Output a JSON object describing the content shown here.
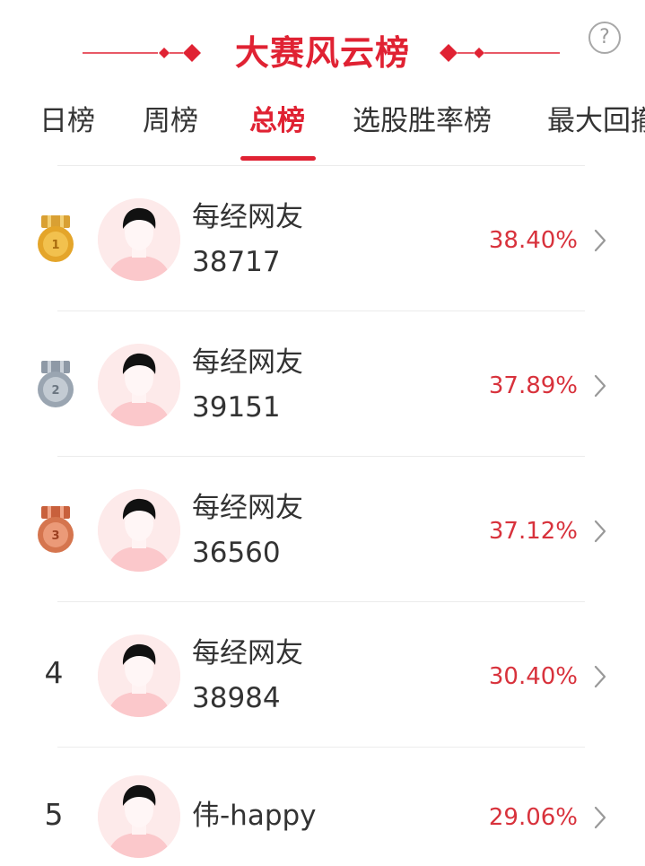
{
  "header": {
    "title": "大赛风云榜",
    "help_label": "?"
  },
  "tabs": [
    {
      "label": "日榜"
    },
    {
      "label": "周榜"
    },
    {
      "label": "总榜"
    },
    {
      "label": "选股胜率榜"
    },
    {
      "label": "最大回撤"
    }
  ],
  "active_tab": "总榜",
  "ranking": [
    {
      "rank": "1",
      "name": "每经网友",
      "score": "38717",
      "rate": "38.40%"
    },
    {
      "rank": "2",
      "name": "每经网友",
      "score": "39151",
      "rate": "37.89%"
    },
    {
      "rank": "3",
      "name": "每经网友",
      "score": "36560",
      "rate": "37.12%"
    },
    {
      "rank": "4",
      "name": "每经网友",
      "score": "38984",
      "rate": "30.40%"
    },
    {
      "rank": "5",
      "name": "伟-happy",
      "score": "",
      "rate": "29.06%"
    }
  ],
  "colors": {
    "accent": "#e02233",
    "rate": "#d8323c",
    "gold": "#e4a52a",
    "silver": "#aab3bd",
    "bronze": "#d5754e",
    "avatar_bg": "#fdeaea",
    "avatar_shirt": "#fbc8cb"
  },
  "icons": [
    "help-icon",
    "medal-gold-icon",
    "medal-silver-icon",
    "medal-bronze-icon",
    "avatar-icon",
    "chevron-right-icon"
  ]
}
